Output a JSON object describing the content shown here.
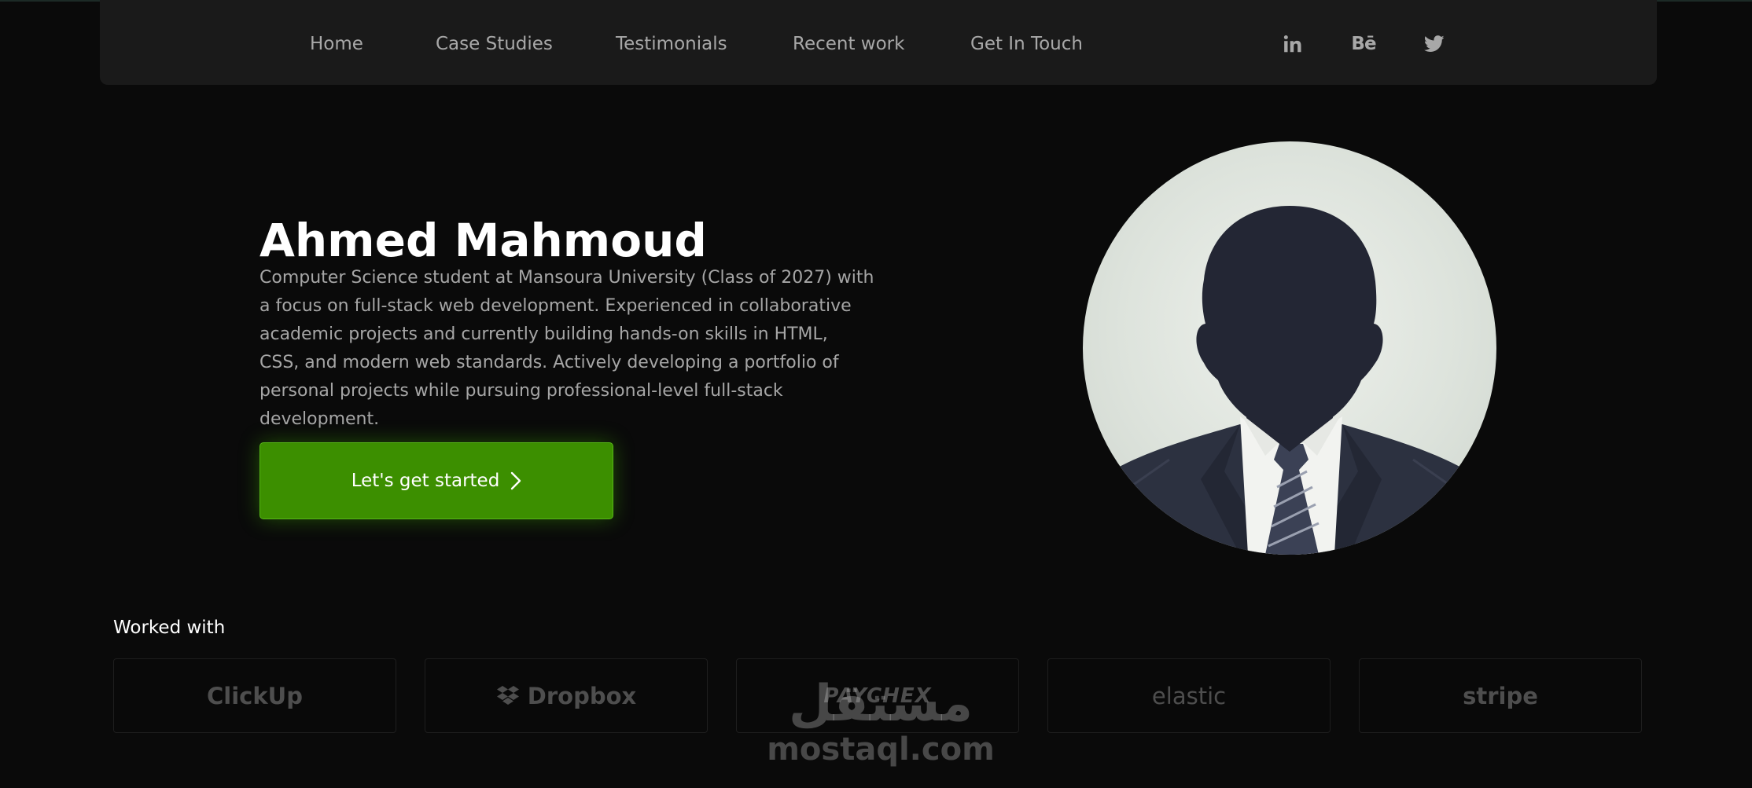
{
  "nav": {
    "links": [
      "Home",
      "Case Studies",
      "Testimonials",
      "Recent work",
      "Get In Touch"
    ],
    "social": {
      "linkedin_icon": "linkedin-icon",
      "behance_label": "Bē",
      "twitter_icon": "twitter-icon"
    }
  },
  "hero": {
    "name": "Ahmed Mahmoud",
    "description_lines": [
      "Computer Science student at Mansoura University (Class of 2027) with",
      "a focus on full-stack web development. Experienced in collaborative",
      "academic projects and currently building hands-on skills in HTML,",
      "CSS, and modern web standards. Actively developing a portfolio of",
      "personal projects while pursuing professional-level full-stack development."
    ],
    "cta_label": "Let's get started",
    "avatar_icon": "person-silhouette-avatar"
  },
  "worked_with": {
    "label": "Worked with",
    "logos": [
      "ClickUp",
      "Dropbox",
      "PAYCHEX",
      "elastic",
      "stripe"
    ]
  },
  "watermark": {
    "arabic": "مستقل",
    "latin": "mostaql.com"
  },
  "colors": {
    "background": "#0a0a0a",
    "navbar": "#1a1a1a",
    "accent_green": "#3c8f00",
    "muted_text": "#a6a6a6"
  }
}
